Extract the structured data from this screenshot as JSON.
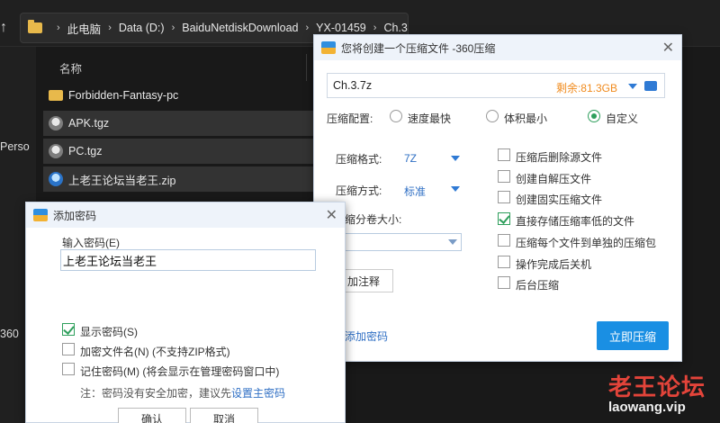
{
  "explorer": {
    "breadcrumb": [
      "此电脑",
      "Data (D:)",
      "BaiduNetdiskDownload",
      "YX-01459",
      "Ch.3"
    ],
    "column_name": "名称",
    "side_labels": [
      "Perso",
      "360"
    ],
    "files": [
      {
        "name": "Forbidden-Fantasy-pc",
        "icon": "folder-icon"
      },
      {
        "name": "APK.tgz",
        "icon": "tgz-file-icon"
      },
      {
        "name": "PC.tgz",
        "icon": "tgz-file-icon"
      },
      {
        "name": "上老王论坛当老王.zip",
        "icon": "zip-file-icon"
      }
    ]
  },
  "compress_dialog": {
    "title": "您将创建一个压缩文件 -360压缩",
    "filename": "Ch.3.7z",
    "remaining": "剩余:81.3GB",
    "config_label": "压缩配置:",
    "modes": [
      "速度最快",
      "体积最小",
      "自定义"
    ],
    "selected_mode": "自定义",
    "format_label": "压缩格式:",
    "format_value": "7Z",
    "method_label": "压缩方式:",
    "method_value": "标准",
    "volume_label": "缩分卷大小:",
    "note_button": "加注释",
    "add_password_link": "添加密码",
    "start_button": "立即压缩",
    "options": [
      {
        "label": "压缩后删除源文件",
        "checked": false
      },
      {
        "label": "创建自解压文件",
        "checked": false
      },
      {
        "label": "创建固实压缩文件",
        "checked": false
      },
      {
        "label": "直接存储压缩率低的文件",
        "checked": true
      },
      {
        "label": "压缩每个文件到单独的压缩包",
        "checked": false
      },
      {
        "label": "操作完成后关机",
        "checked": false
      },
      {
        "label": "后台压缩",
        "checked": false
      }
    ],
    "accent_color": "#1a8fe3"
  },
  "password_dialog": {
    "title": "添加密码",
    "input_label": "输入密码(E)",
    "password_value": "上老王论坛当老王",
    "show_password": "显示密码(S)",
    "encrypt_names": "加密文件名(N) (不支持ZIP格式)",
    "remember_password": "记住密码(M) (将会显示在管理密码窗口中)",
    "note_prefix": "注：密码没有安全加密，建议先",
    "note_link": "设置主密码",
    "ok": "确认",
    "cancel": "取消"
  },
  "watermark": {
    "name": "老王论坛",
    "url": "laowang.vip"
  }
}
